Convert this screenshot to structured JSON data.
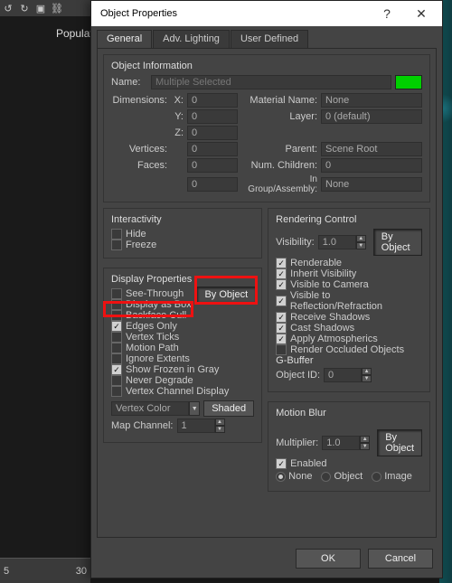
{
  "app": {
    "populate_label": "Populate",
    "timeline": {
      "t0": "5",
      "t1": "30"
    }
  },
  "dialog": {
    "title": "Object Properties",
    "help": "?",
    "close": "✕",
    "tabs": {
      "general": "General",
      "adv_lighting": "Adv. Lighting",
      "user_defined": "User Defined"
    },
    "object_info": {
      "title": "Object Information",
      "name_label": "Name:",
      "name_value": "Multiple Selected",
      "dim_label": "Dimensions:",
      "x_label": "X:",
      "x_value": "0",
      "y_label": "Y:",
      "y_value": "0",
      "z_label": "Z:",
      "z_value": "0",
      "material_label": "Material Name:",
      "material_value": "None",
      "layer_label": "Layer:",
      "layer_value": "0 (default)",
      "vertices_label": "Vertices:",
      "vertices_value": "0",
      "parent_label": "Parent:",
      "parent_value": "Scene Root",
      "faces_label": "Faces:",
      "faces_value": "0",
      "children_label": "Num. Children:",
      "children_value": "0",
      "extra_value": "0",
      "group_label": "In Group/Assembly:",
      "group_value": "None"
    },
    "interactivity": {
      "title": "Interactivity",
      "hide": "Hide",
      "freeze": "Freeze"
    },
    "display": {
      "title": "Display Properties",
      "by_object": "By Object",
      "see_through": "See-Through",
      "display_as_box": "Display as Box",
      "backface_cull": "Backface Cull",
      "edges_only": "Edges Only",
      "vertex_ticks": "Vertex Ticks",
      "motion_path": "Motion Path",
      "ignore_extents": "Ignore Extents",
      "show_frozen": "Show Frozen in Gray",
      "never_degrade": "Never Degrade",
      "vertex_channel": "Vertex Channel Display",
      "combo_value": "Vertex Color",
      "shaded": "Shaded",
      "map_channel_label": "Map Channel:",
      "map_channel_value": "1"
    },
    "rendering": {
      "title": "Rendering Control",
      "visibility_label": "Visibility:",
      "visibility_value": "1.0",
      "by_object": "By Object",
      "renderable": "Renderable",
      "inherit": "Inherit Visibility",
      "vis_cam": "Visible to Camera",
      "vis_rr": "Visible to Reflection/Refraction",
      "rec_sh": "Receive Shadows",
      "cast_sh": "Cast Shadows",
      "apply_atm": "Apply Atmospherics",
      "render_occ": "Render Occluded Objects"
    },
    "gbuffer": {
      "title": "G-Buffer",
      "obj_id_label": "Object ID:",
      "obj_id_value": "0"
    },
    "motion_blur": {
      "title": "Motion Blur",
      "mult_label": "Multiplier:",
      "mult_value": "1.0",
      "by_object": "By Object",
      "enabled": "Enabled",
      "none": "None",
      "object": "Object",
      "image": "Image"
    },
    "buttons": {
      "ok": "OK",
      "cancel": "Cancel"
    }
  }
}
